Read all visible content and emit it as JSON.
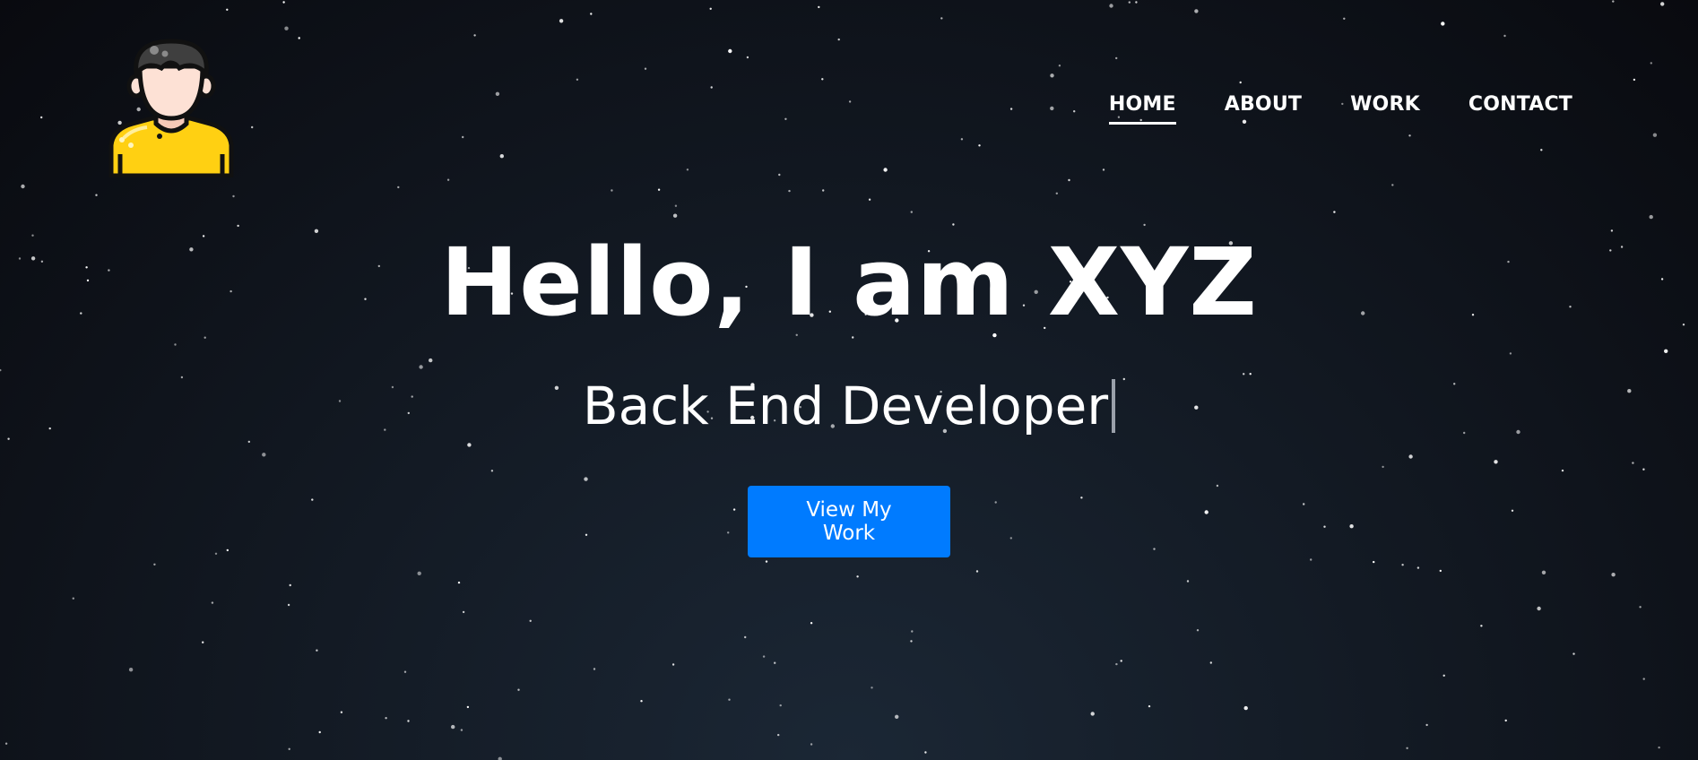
{
  "nav": {
    "items": [
      {
        "label": "HOME",
        "active": true
      },
      {
        "label": "ABOUT",
        "active": false
      },
      {
        "label": "WORK",
        "active": false
      },
      {
        "label": "CONTACT",
        "active": false
      }
    ]
  },
  "hero": {
    "title": "Hello, I am XYZ",
    "subtitle": "Back End Developer",
    "cta_label": "View My Work"
  },
  "colors": {
    "accent": "#007bff",
    "background_top": "#090a0f",
    "background_bottom": "#1b2735",
    "avatar_shirt": "#ffd012",
    "avatar_hair": "#3f3f3f"
  },
  "icons": {
    "logo": "developer-avatar-icon",
    "cursor": "typing-cursor-icon"
  }
}
